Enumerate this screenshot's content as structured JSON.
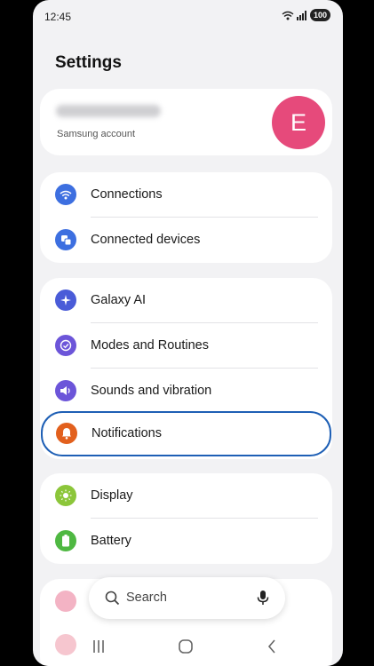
{
  "status": {
    "time": "12:45",
    "battery": "100"
  },
  "title": "Settings",
  "account": {
    "subtitle": "Samsung account",
    "avatar_letter": "E"
  },
  "groups": [
    [
      {
        "label": "Connections",
        "icon": "wifi-icon",
        "color": "#3d6fe0"
      },
      {
        "label": "Connected devices",
        "icon": "connected-devices-icon",
        "color": "#3d6fe0"
      }
    ],
    [
      {
        "label": "Galaxy AI",
        "icon": "galaxy-ai-icon",
        "color": "#4a5cd8"
      },
      {
        "label": "Modes and Routines",
        "icon": "modes-routines-icon",
        "color": "#6c55d9"
      },
      {
        "label": "Sounds and vibration",
        "icon": "sound-icon",
        "color": "#6c55d9"
      },
      {
        "label": "Notifications",
        "icon": "bell-icon",
        "color": "#e2601d"
      }
    ],
    [
      {
        "label": "Display",
        "icon": "display-icon",
        "color": "#8cc63a"
      },
      {
        "label": "Battery",
        "icon": "battery-icon",
        "color": "#4fb842"
      }
    ]
  ],
  "search": {
    "placeholder": "Search"
  }
}
